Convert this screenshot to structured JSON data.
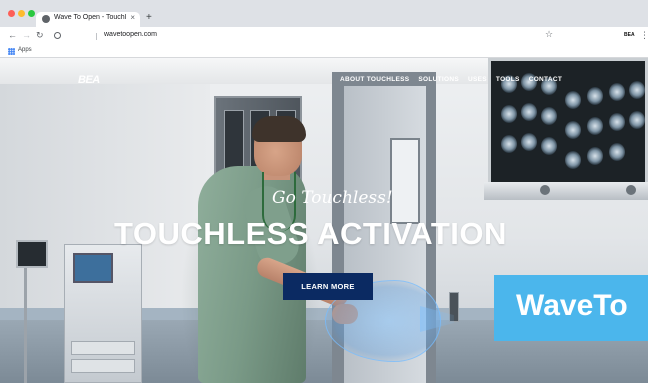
{
  "browser": {
    "tab_title": "Wave To Open - Touchless Act",
    "tab_close": "×",
    "new_tab": "+",
    "url": "wavetoopen.com",
    "bookmarks": {
      "apps_label": "Apps"
    },
    "extension_label": "BEA",
    "icons": [
      "back-arrow-icon",
      "forward-arrow-icon",
      "reload-icon",
      "info-icon",
      "star-icon",
      "menu-icon",
      "apps-icon"
    ]
  },
  "site": {
    "logo": "BEA",
    "nav": [
      "ABOUT TOUCHLESS",
      "SOLUTIONS",
      "USES",
      "TOOLS",
      "CONTACT"
    ],
    "tagline": "Go Touchless!",
    "headline": "TOUCHLESS ACTIVATION",
    "cta_label": "LEARN MORE",
    "brand_badge": "WaveTo"
  },
  "colors": {
    "cta_bg": "#0b2a62",
    "badge_bg": "#4bb6ec",
    "scrubs": "#7a9a87"
  }
}
